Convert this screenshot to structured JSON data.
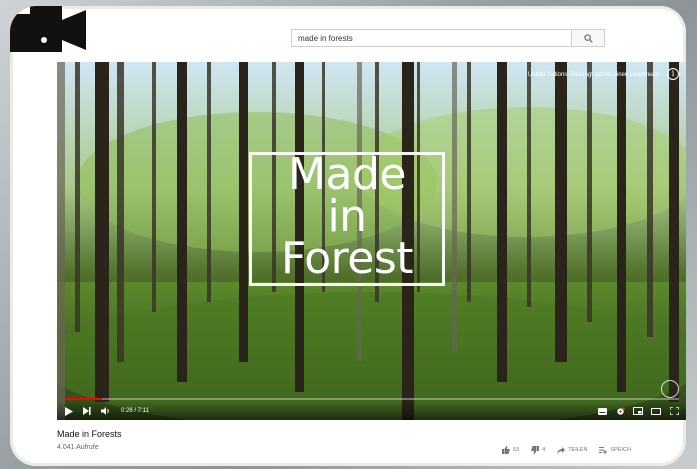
{
  "search": {
    "value": "made in forests",
    "icon": "search-icon"
  },
  "player": {
    "livestream_note": "United Nations überträgt aktuell einen Livestream.",
    "title_overlay": "Made\nin\nForest",
    "time": "0:26 / 7:11",
    "progress_fraction": 0.0603
  },
  "video": {
    "title": "Made in Forests",
    "views": "4.041 Aufrufe"
  },
  "actions": {
    "likes": "53",
    "dislikes": "4",
    "share": "TEILEN",
    "save": "SPEICH"
  },
  "colors": {
    "progress": "#ff0000",
    "background": "#ffffff"
  }
}
